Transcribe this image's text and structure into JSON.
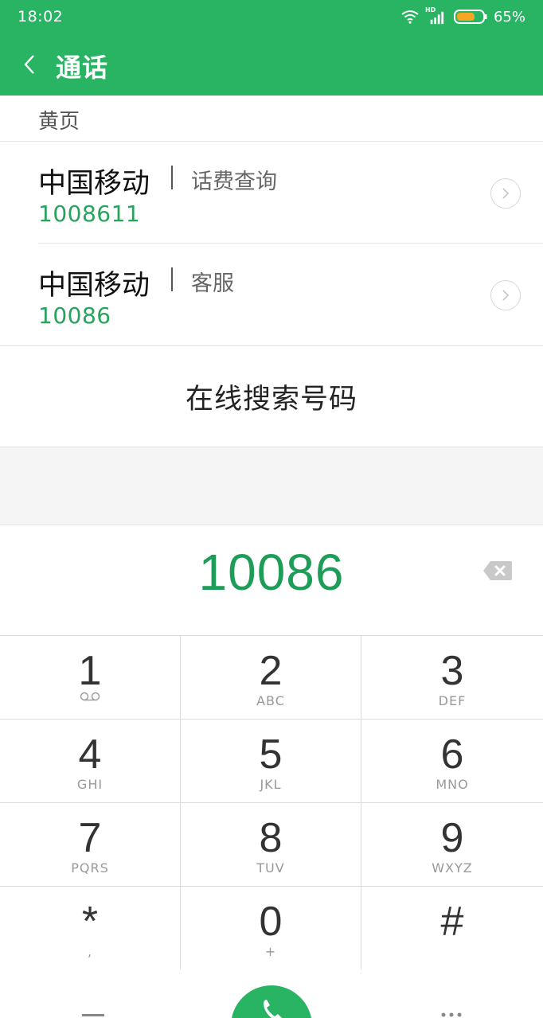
{
  "status": {
    "time": "18:02",
    "network": "HD",
    "battery": "65%",
    "battery_color": "#f5a623"
  },
  "appbar": {
    "title": "通话",
    "color": "#29b463"
  },
  "yellow_pages": {
    "header": "黄页",
    "entries": [
      {
        "name": "中国移动",
        "tag": "话费查询",
        "number": "1008611"
      },
      {
        "name": "中国移动",
        "tag": "客服",
        "number": "10086"
      }
    ],
    "search_online": "在线搜索号码"
  },
  "dialer": {
    "input": "10086",
    "keys": [
      {
        "main": "1",
        "sub": ""
      },
      {
        "main": "2",
        "sub": "ABC"
      },
      {
        "main": "3",
        "sub": "DEF"
      },
      {
        "main": "4",
        "sub": "GHI"
      },
      {
        "main": "5",
        "sub": "JKL"
      },
      {
        "main": "6",
        "sub": "MNO"
      },
      {
        "main": "7",
        "sub": "PQRS"
      },
      {
        "main": "8",
        "sub": "TUV"
      },
      {
        "main": "9",
        "sub": "WXYZ"
      },
      {
        "main": "*",
        "sub": ","
      },
      {
        "main": "0",
        "sub": "+"
      },
      {
        "main": "#",
        "sub": ""
      }
    ]
  },
  "icons": {
    "back": "chevron-left-icon",
    "arrow": "chevron-right-icon",
    "delete": "backspace-icon",
    "voicemail": "voicemail-icon",
    "call": "phone-icon",
    "menu": "menu-icon",
    "keypad": "dialpad-icon"
  }
}
